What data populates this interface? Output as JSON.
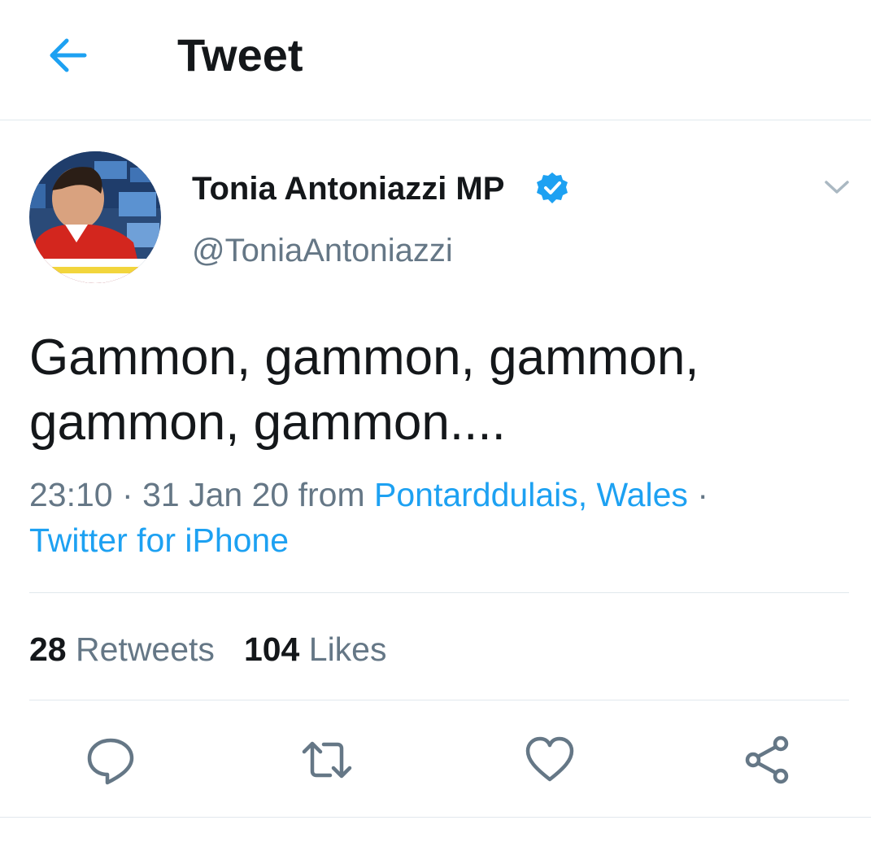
{
  "header": {
    "title": "Tweet",
    "back_icon": "arrow-left-icon"
  },
  "colors": {
    "accent": "#1da1f2",
    "text_primary": "#14171a",
    "text_secondary": "#657786",
    "divider": "#e1e8ed",
    "icon_gray": "#657786"
  },
  "author": {
    "display_name": "Tonia Antoniazzi MP",
    "handle": "@ToniaAntoniazzi",
    "verified": true,
    "avatar_icon": "avatar-photo",
    "menu_icon": "chevron-down-icon"
  },
  "tweet": {
    "text_line1": "Gammon, gammon, gammon,",
    "text_line2": "gammon, gammon....",
    "time": "23:10",
    "separator": "·",
    "date": "31 Jan 20",
    "from_label": "from",
    "location": "Pontarddulais, Wales",
    "source": "Twitter for iPhone"
  },
  "stats": {
    "retweets_count": "28",
    "retweets_label": "Retweets",
    "likes_count": "104",
    "likes_label": "Likes"
  },
  "actions": [
    {
      "name": "reply",
      "icon": "speech-bubble-icon"
    },
    {
      "name": "retweet",
      "icon": "retweet-icon"
    },
    {
      "name": "like",
      "icon": "heart-icon"
    },
    {
      "name": "share",
      "icon": "share-icon"
    }
  ]
}
